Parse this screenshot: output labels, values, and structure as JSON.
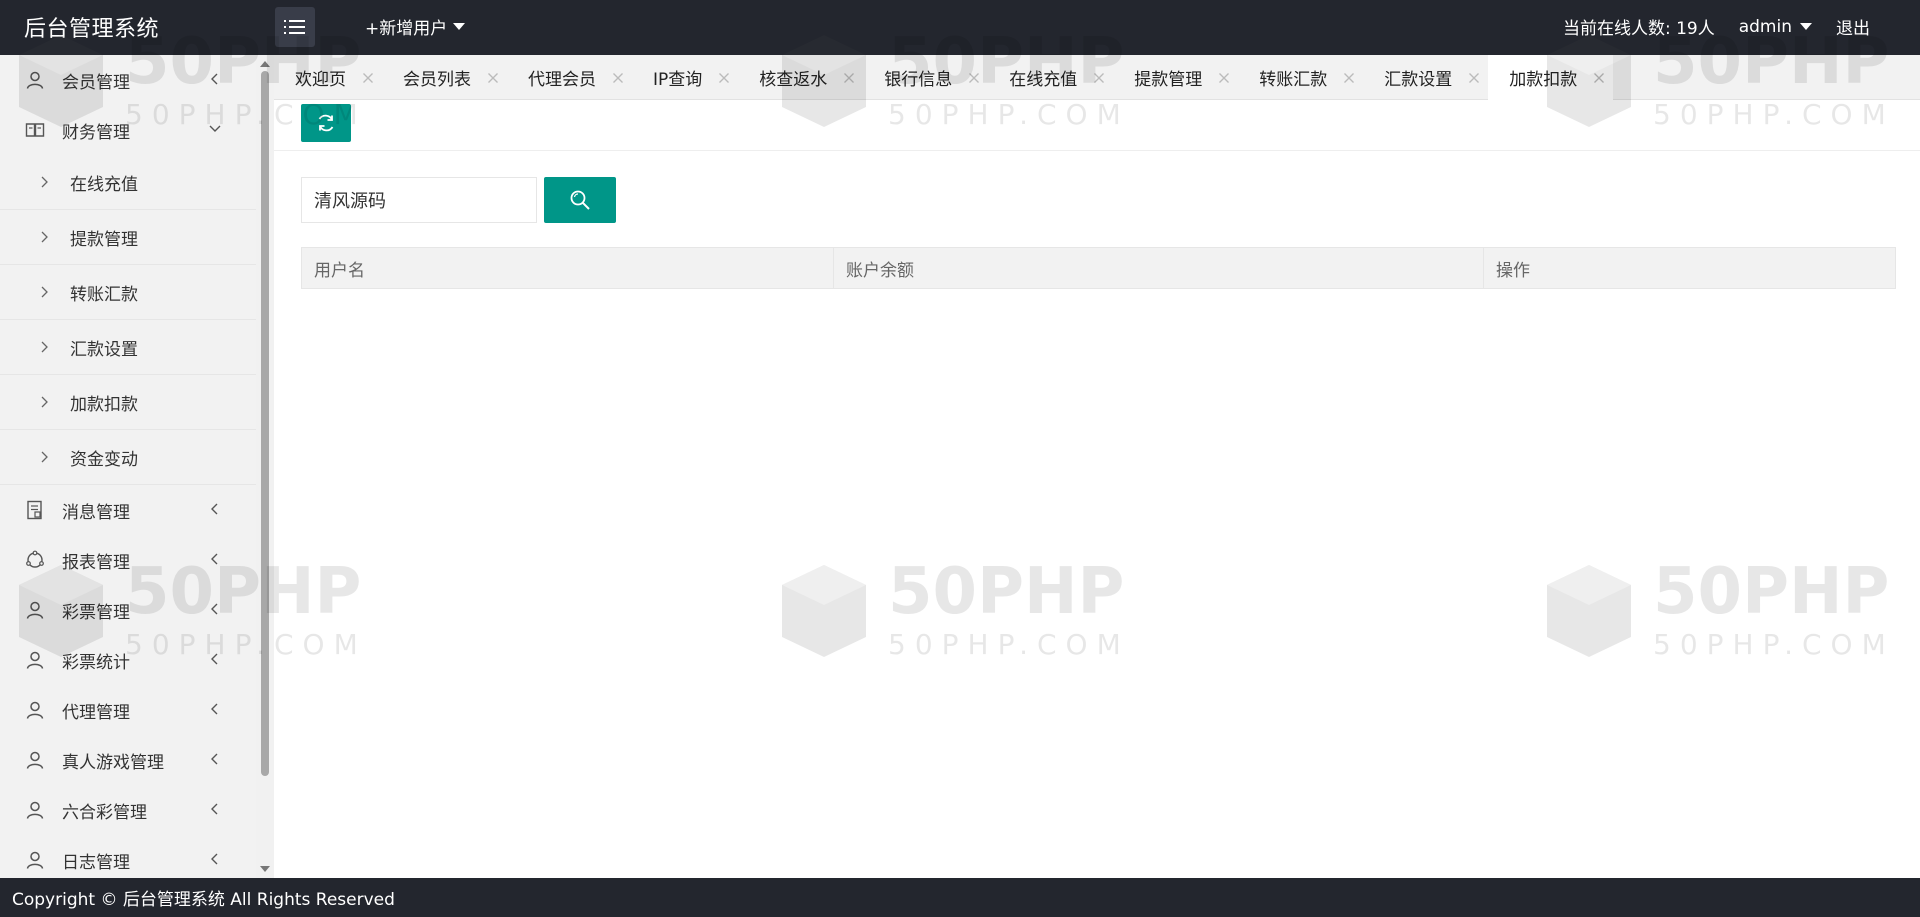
{
  "header": {
    "logo": "后台管理系统",
    "add_user": "+新增用户",
    "online": "当前在线人数: 19人",
    "admin": "admin",
    "logout": "退出"
  },
  "sidebar": {
    "items": [
      {
        "label": "会员管理",
        "icon": "user-icon"
      },
      {
        "label": "财务管理",
        "icon": "book-icon",
        "expanded": true,
        "children": [
          "在线充值",
          "提款管理",
          "转账汇款",
          "汇款设置",
          "加款扣款",
          "资金变动"
        ]
      },
      {
        "label": "消息管理",
        "icon": "document-icon"
      },
      {
        "label": "报表管理",
        "icon": "cycle-icon"
      },
      {
        "label": "彩票管理",
        "icon": "user-icon"
      },
      {
        "label": "彩票统计",
        "icon": "user-icon"
      },
      {
        "label": "代理管理",
        "icon": "user-icon"
      },
      {
        "label": "真人游戏管理",
        "icon": "user-icon"
      },
      {
        "label": "六合彩管理",
        "icon": "user-icon"
      },
      {
        "label": "日志管理",
        "icon": "user-icon"
      }
    ]
  },
  "tabs": [
    {
      "label": "欢迎页"
    },
    {
      "label": "会员列表"
    },
    {
      "label": "代理会员"
    },
    {
      "label": "IP查询"
    },
    {
      "label": "核查返水"
    },
    {
      "label": "银行信息"
    },
    {
      "label": "在线充值"
    },
    {
      "label": "提款管理"
    },
    {
      "label": "转账汇款"
    },
    {
      "label": "汇款设置"
    },
    {
      "label": "加款扣款",
      "active": true
    }
  ],
  "search": {
    "value": "清风源码"
  },
  "table": {
    "headers": [
      "用户名",
      "账户余额",
      "操作"
    ]
  },
  "watermark": {
    "brand": "50PHP",
    "domain": "50PHP.COM"
  },
  "footer": {
    "text": "Copyright © 后台管理系统 All Rights Reserved"
  },
  "colors": {
    "header_bg": "#23262e",
    "accent": "#009688",
    "sidebar_bg": "#f2f2f2"
  }
}
